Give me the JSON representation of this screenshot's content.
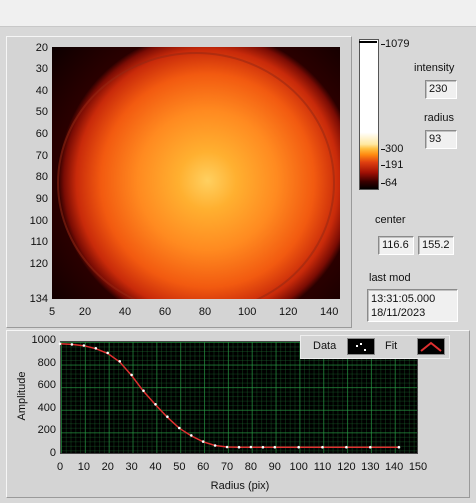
{
  "image_panel": {
    "y_ticks": [
      "20",
      "30",
      "40",
      "50",
      "60",
      "70",
      "80",
      "90",
      "100",
      "110",
      "120",
      "134"
    ],
    "x_ticks": [
      "5",
      "20",
      "40",
      "60",
      "80",
      "100",
      "120",
      "140"
    ]
  },
  "colorbar": {
    "labels": [
      "1079",
      "300",
      "191",
      "64"
    ]
  },
  "indicators": {
    "intensity_label": "intensity",
    "intensity_value": "230",
    "radius_label": "radius",
    "radius_value": "93",
    "center_label": "center",
    "center_x": "116.6",
    "center_y": "155.2",
    "last_mod_label": "last mod",
    "last_mod_time": "13:31:05.000",
    "last_mod_date": "18/11/2023"
  },
  "chart_data": {
    "type": "scatter",
    "xlabel": "Radius (pix)",
    "ylabel": "Amplitude",
    "xlim": [
      0,
      150
    ],
    "ylim": [
      0,
      1000
    ],
    "x_ticks": [
      "0",
      "10",
      "20",
      "30",
      "40",
      "50",
      "60",
      "70",
      "80",
      "90",
      "100",
      "110",
      "120",
      "130",
      "140",
      "150"
    ],
    "y_ticks": [
      "1000",
      "800",
      "600",
      "400",
      "200",
      "0"
    ],
    "grid": true,
    "legend": "top-right",
    "legend_items": [
      "Data",
      "Fit"
    ],
    "series": [
      {
        "name": "Data",
        "color": "#ffffff",
        "x": [
          0,
          5,
          10,
          15,
          20,
          25,
          30,
          35,
          40,
          45,
          50,
          55,
          60,
          65,
          70,
          75,
          80,
          85,
          90,
          100,
          110,
          120,
          130,
          142
        ],
        "y": [
          975,
          970,
          960,
          935,
          895,
          820,
          700,
          560,
          440,
          330,
          230,
          165,
          110,
          75,
          62,
          60,
          62,
          60,
          60,
          60,
          60,
          60,
          60,
          60
        ]
      },
      {
        "name": "Fit",
        "color": "#e03030",
        "x": [
          0,
          5,
          10,
          15,
          20,
          25,
          30,
          35,
          40,
          45,
          50,
          55,
          60,
          65,
          70,
          75,
          80,
          90,
          100,
          110,
          120,
          130,
          142
        ],
        "y": [
          975,
          970,
          958,
          932,
          890,
          815,
          695,
          555,
          435,
          325,
          228,
          160,
          108,
          75,
          62,
          60,
          60,
          60,
          60,
          60,
          60,
          60,
          60
        ]
      }
    ]
  }
}
